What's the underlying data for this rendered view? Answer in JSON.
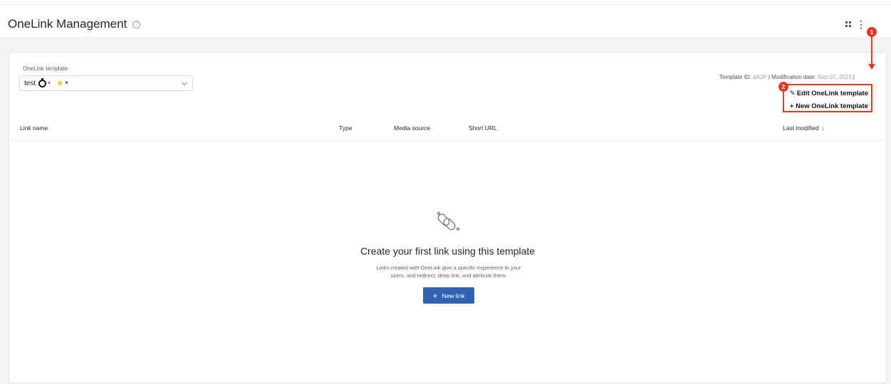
{
  "page": {
    "title": "OneLink Management",
    "help_icon": "question-circle-icon"
  },
  "template": {
    "label": "OneLink template:",
    "selected": "test",
    "icons": [
      "stopwatch-icon",
      "apple-icon",
      "star-icon",
      "android-icon"
    ]
  },
  "meta": {
    "template_id_label": "Template ID:",
    "template_id": "dA2P",
    "separator": "|",
    "modification_label": "Modification date:",
    "modification_date": "Sep 07, 2023"
  },
  "table": {
    "columns": {
      "link_name": "Link name",
      "type": "Type",
      "media_source": "Media source",
      "short_url": "Short URL",
      "last_modified": "Last modified"
    },
    "sort_icon": "arrow-down-icon"
  },
  "empty_state": {
    "icon": "broken-link-icon",
    "title": "Create your first link using this template",
    "text_line1": "Links created with OneLink give a specific experience to your",
    "text_line2": "users, and redirect, deep link, and attribute them.",
    "button_label": "New link",
    "button_plus": "+"
  },
  "menu": {
    "edit_label": "Edit OneLink template",
    "edit_icon": "pencil-icon",
    "new_label": "+ New OneLink template"
  },
  "annotations": {
    "badge1": "1",
    "badge2": "2",
    "color": "#e5391f"
  },
  "colors": {
    "accent": "#2e64b3",
    "annotation": "#e5391f"
  }
}
